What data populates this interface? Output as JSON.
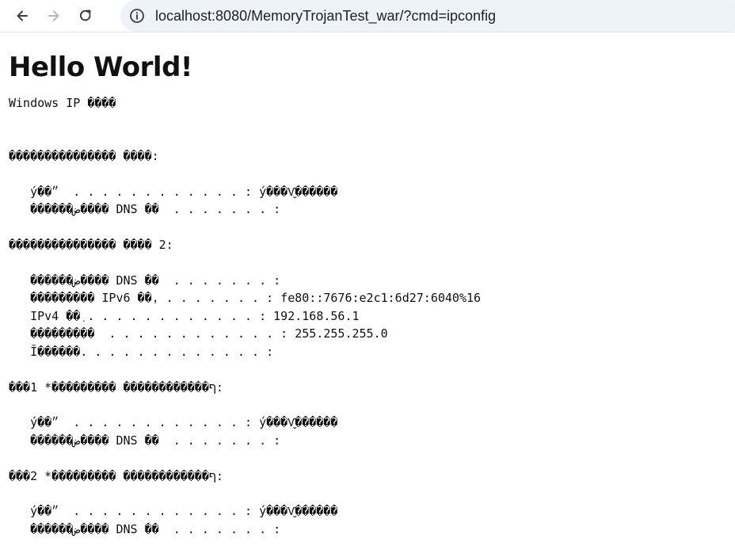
{
  "browser": {
    "url": "localhost:8080/MemoryTrojanTest_war/?cmd=ipconfig"
  },
  "page": {
    "heading": "Hello World!",
    "output_lines": [
      "Windows IP ����",
      "",
      "",
      "��������������� ����:",
      "",
      "   ý��״  . . . . . . . . . . . . : ý���Ѵ̬������",
      "   ������ض���� DNS ��  . . . . . . . :",
      "",
      "��������������� ���� 2:",
      "",
      "   ������ض���� DNS ��  . . . . . . . :",
      "   ��������� IPv6 ��ַ. . . . . . . . : fe80::7676:e2c1:6d27:6040%16",
      "   IPv4 ��ַ . . . . . . . . . . . . : 192.168.56.1",
      "   ���������  . . . . . . . . . . . . : 255.255.255.0",
      "   Ĭ������. . . . . . . . . . . . . :",
      "",
      "���1 *��������� ������������ף:",
      "",
      "   ý��״  . . . . . . . . . . . . : ý���Ѵ̬������",
      "   ������ض���� DNS ��  . . . . . . . :",
      "",
      "���2 *��������� ������������ף:",
      "",
      "   ý��״  . . . . . . . . . . . . : ý���Ѵ̬������",
      "   ������ض���� DNS ��  . . . . . . . :"
    ]
  }
}
